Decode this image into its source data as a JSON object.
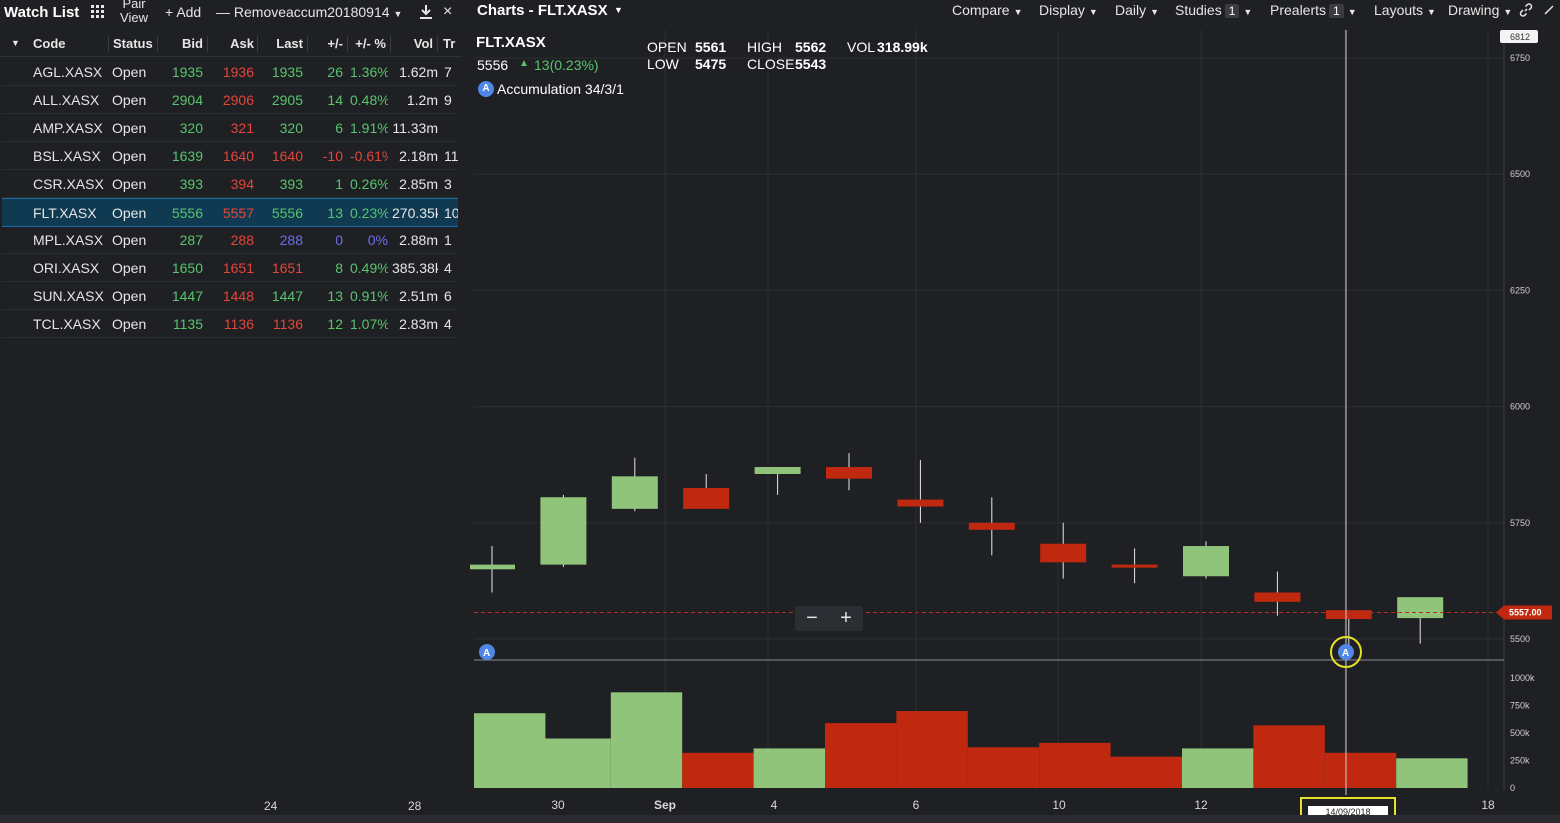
{
  "watchlist": {
    "title": "Watch List",
    "pair_view": "Pair View",
    "add_label": "Add",
    "remove_label": "Remove",
    "list_name": "accum20180914",
    "columns": [
      "Code",
      "Status",
      "Bid",
      "Ask",
      "Last",
      "+/-",
      "+/- %",
      "Vol",
      "Tr"
    ],
    "rows": [
      {
        "code": "AGL.XASX",
        "status": "Open",
        "bid": "1935",
        "ask": "1936",
        "last": "1935",
        "chg": "26",
        "pct": "1.36%",
        "vol": "1.62m",
        "tr": "7",
        "dir": "up"
      },
      {
        "code": "ALL.XASX",
        "status": "Open",
        "bid": "2904",
        "ask": "2906",
        "last": "2905",
        "chg": "14",
        "pct": "0.48%",
        "vol": "1.2m",
        "tr": "9",
        "dir": "up"
      },
      {
        "code": "AMP.XASX",
        "status": "Open",
        "bid": "320",
        "ask": "321",
        "last": "320",
        "chg": "6",
        "pct": "1.91%",
        "vol": "11.33m",
        "tr": "",
        "dir": "up"
      },
      {
        "code": "BSL.XASX",
        "status": "Open",
        "bid": "1639",
        "ask": "1640",
        "last": "1640",
        "chg": "-10",
        "pct": "-0.61%",
        "vol": "2.18m",
        "tr": "11",
        "dir": "down"
      },
      {
        "code": "CSR.XASX",
        "status": "Open",
        "bid": "393",
        "ask": "394",
        "last": "393",
        "chg": "1",
        "pct": "0.26%",
        "vol": "2.85m",
        "tr": "3",
        "dir": "up"
      },
      {
        "code": "FLT.XASX",
        "status": "Open",
        "bid": "5556",
        "ask": "5557",
        "last": "5556",
        "chg": "13",
        "pct": "0.23%",
        "vol": "270.35k",
        "tr": "10",
        "dir": "up",
        "selected": true
      },
      {
        "code": "MPL.XASX",
        "status": "Open",
        "bid": "287",
        "ask": "288",
        "last": "288",
        "chg": "0",
        "pct": "0%",
        "vol": "2.88m",
        "tr": "1",
        "dir": "flat"
      },
      {
        "code": "ORI.XASX",
        "status": "Open",
        "bid": "1650",
        "ask": "1651",
        "last": "1651",
        "chg": "8",
        "pct": "0.49%",
        "vol": "385.38k",
        "tr": "4",
        "dir": "up"
      },
      {
        "code": "SUN.XASX",
        "status": "Open",
        "bid": "1447",
        "ask": "1448",
        "last": "1447",
        "chg": "13",
        "pct": "0.91%",
        "vol": "2.51m",
        "tr": "6",
        "dir": "up"
      },
      {
        "code": "TCL.XASX",
        "status": "Open",
        "bid": "1135",
        "ask": "1136",
        "last": "1136",
        "chg": "12",
        "pct": "1.07%",
        "vol": "2.83m",
        "tr": "4",
        "dir": "up"
      }
    ]
  },
  "chart_header": {
    "title": "Charts - FLT.XASX",
    "menu": [
      {
        "label": "Compare"
      },
      {
        "label": "Display"
      },
      {
        "label": "Daily"
      },
      {
        "label": "Studies",
        "badge": "1"
      },
      {
        "label": "Prealerts",
        "badge": "1"
      },
      {
        "label": "Layouts"
      },
      {
        "label": "Drawing"
      }
    ]
  },
  "quote": {
    "symbol": "FLT.XASX",
    "last": "5556",
    "change": "13(0.23%)",
    "open_label": "OPEN",
    "open": "5561",
    "high_label": "HIGH",
    "high": "5562",
    "low_label": "LOW",
    "low": "5475",
    "close_label": "CLOSE",
    "close": "5543",
    "vol_label": "VOL",
    "vol": "318.99k",
    "study_marker": "A",
    "study": "Accumulation 34/3/1"
  },
  "colors": {
    "up": "#8fc47a",
    "down": "#c0290f",
    "accent": "#4f86e8",
    "highlight": "#e6e12a"
  },
  "current_price_label": "5557.00",
  "crosshair_date": "14/09/2018",
  "chart_data": {
    "type": "candlestick",
    "price_axis": {
      "ticks": [
        6812,
        6750,
        6500,
        6250,
        6000,
        5750,
        5500
      ],
      "ylim": [
        5400,
        6860
      ]
    },
    "volume_axis": {
      "ticks": [
        "1000k",
        "750k",
        "500k",
        "250k",
        "0"
      ],
      "ylim": [
        0,
        1000000
      ]
    },
    "x_tick_labels": [
      "24",
      "28",
      "30",
      "Sep",
      "4",
      "6",
      "10",
      "12",
      "14",
      "18"
    ],
    "current_price": 5557,
    "candles": [
      {
        "date": "29 Aug",
        "open": 5650,
        "high": 5700,
        "low": 5600,
        "close": 5660,
        "volume": 680000
      },
      {
        "date": "30 Aug",
        "open": 5660,
        "high": 5810,
        "low": 5655,
        "close": 5805,
        "volume": 450000
      },
      {
        "date": "31 Aug",
        "open": 5780,
        "high": 5890,
        "low": 5775,
        "close": 5850,
        "volume": 870000
      },
      {
        "date": "3 Sep",
        "open": 5825,
        "high": 5855,
        "low": 5800,
        "close": 5780,
        "volume": 320000
      },
      {
        "date": "4 Sep",
        "open": 5855,
        "high": 5870,
        "low": 5810,
        "close": 5870,
        "volume": 360000
      },
      {
        "date": "5 Sep",
        "open": 5870,
        "high": 5900,
        "low": 5820,
        "close": 5845,
        "volume": 590000
      },
      {
        "date": "6 Sep",
        "open": 5800,
        "high": 5885,
        "low": 5750,
        "close": 5785,
        "volume": 700000
      },
      {
        "date": "7 Sep",
        "open": 5750,
        "high": 5805,
        "low": 5680,
        "close": 5735,
        "volume": 370000
      },
      {
        "date": "10 Sep",
        "open": 5705,
        "high": 5750,
        "low": 5630,
        "close": 5665,
        "volume": 410000
      },
      {
        "date": "11 Sep",
        "open": 5660,
        "high": 5695,
        "low": 5620,
        "close": 5655,
        "volume": 285000
      },
      {
        "date": "12 Sep",
        "open": 5635,
        "high": 5710,
        "low": 5630,
        "close": 5700,
        "volume": 360000
      },
      {
        "date": "13 Sep",
        "open": 5600,
        "high": 5645,
        "low": 5550,
        "close": 5580,
        "volume": 570000
      },
      {
        "date": "14 Sep",
        "open": 5562,
        "high": 5562,
        "low": 5475,
        "close": 5543,
        "volume": 320000
      },
      {
        "date": "17 Sep",
        "open": 5545,
        "high": 5580,
        "low": 5490,
        "close": 5590,
        "volume": 270000
      }
    ]
  }
}
